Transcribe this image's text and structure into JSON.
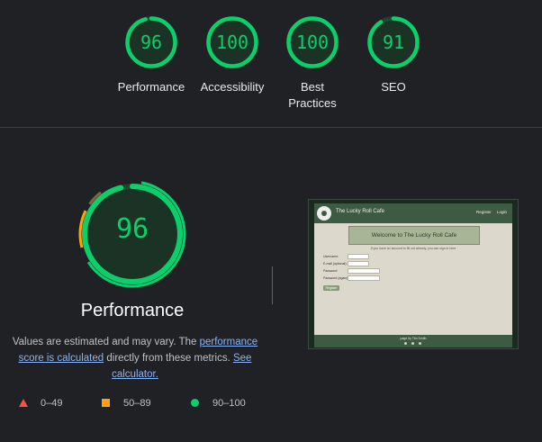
{
  "summary": [
    {
      "score": "96",
      "label": "Performance",
      "fraction": 0.96
    },
    {
      "score": "100",
      "label": "Accessibility",
      "fraction": 1.0
    },
    {
      "score": "100",
      "label_line1": "Best",
      "label_line2": "Practices",
      "fraction": 1.0
    },
    {
      "score": "91",
      "label": "SEO",
      "fraction": 0.91
    }
  ],
  "detail": {
    "score": "96",
    "title": "Performance",
    "desc_part1": "Values are estimated and may vary. The ",
    "desc_link1": "performance score is calculated",
    "desc_part2": " directly from these metrics. ",
    "desc_link2": "See calculator."
  },
  "legend": [
    {
      "range": "0–49",
      "color": "#ff4e42",
      "icon": "triangle-icon"
    },
    {
      "range": "50–89",
      "color": "#ffa400",
      "icon": "square-icon"
    },
    {
      "range": "90–100",
      "color": "#0cce6b",
      "icon": "circle-icon"
    }
  ],
  "screenshot": {
    "site_title": "The Lucky Roll Cafe",
    "nav_register": "Register",
    "nav_login": "Login",
    "banner": "Welcome to The Lucky Roll Cafe",
    "subtext": "If you have an account to fill out already, you can sign in here",
    "field1_label": "Username:",
    "field1_placeholder": "Username",
    "field2_label": "E-mail (optional):",
    "field2_placeholder": "Email address",
    "field3_label": "Password:",
    "field3_placeholder": "Password",
    "field4_label": "Password (again):",
    "field4_placeholder": "Password again",
    "register_button": "Register",
    "footer_text": "page by Tim Smith"
  },
  "colors": {
    "pass": "#0cce6b",
    "average": "#ffa400",
    "fail": "#ff4e42",
    "background": "#202124"
  }
}
